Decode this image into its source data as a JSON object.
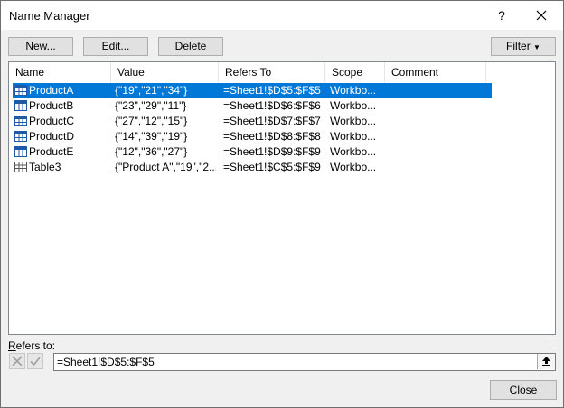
{
  "window": {
    "title": "Name Manager",
    "help": "?"
  },
  "toolbar": {
    "new_ul": "N",
    "new_rest": "ew...",
    "edit_ul": "E",
    "edit_rest": "dit...",
    "delete_ul": "D",
    "delete_rest": "elete",
    "filter_ul": "F",
    "filter_rest": "ilter"
  },
  "columns": [
    "Name",
    "Value",
    "Refers To",
    "Scope",
    "Comment"
  ],
  "rows": [
    {
      "name": "ProductA",
      "value": "{\"19\",\"21\",\"34\"}",
      "refers": "=Sheet1!$D$5:$F$5",
      "scope": "Workbo...",
      "comment": "",
      "selected": true,
      "icon": "named-range-icon"
    },
    {
      "name": "ProductB",
      "value": "{\"23\",\"29\",\"11\"}",
      "refers": "=Sheet1!$D$6:$F$6",
      "scope": "Workbo...",
      "comment": "",
      "icon": "named-range-icon"
    },
    {
      "name": "ProductC",
      "value": "{\"27\",\"12\",\"15\"}",
      "refers": "=Sheet1!$D$7:$F$7",
      "scope": "Workbo...",
      "comment": "",
      "icon": "named-range-icon"
    },
    {
      "name": "ProductD",
      "value": "{\"14\",\"39\",\"19\"}",
      "refers": "=Sheet1!$D$8:$F$8",
      "scope": "Workbo...",
      "comment": "",
      "icon": "named-range-icon"
    },
    {
      "name": "ProductE",
      "value": "{\"12\",\"36\",\"27\"}",
      "refers": "=Sheet1!$D$9:$F$9",
      "scope": "Workbo...",
      "comment": "",
      "icon": "named-range-icon"
    },
    {
      "name": "Table3",
      "value": "{\"Product A\",\"19\",\"2...",
      "refers": "=Sheet1!$C$5:$F$9",
      "scope": "Workbo...",
      "comment": "",
      "icon": "table-icon"
    }
  ],
  "refers_to": {
    "label_ul": "R",
    "label_rest": "efers to:",
    "value": "=Sheet1!$D$5:$F$5"
  },
  "footer": {
    "close_label": "Close"
  },
  "colors": {
    "selection": "#0078d7",
    "icon_blue": "#1e5aa8"
  }
}
